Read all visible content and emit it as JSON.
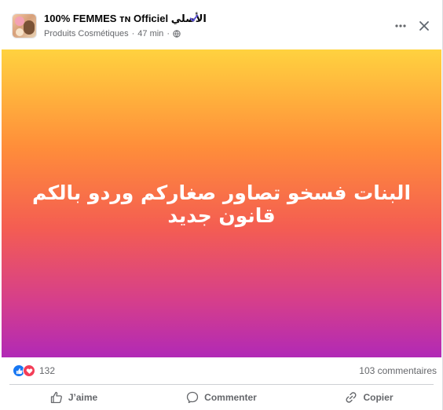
{
  "header": {
    "page_name": "100% FEMMES ᴛɴ Officiel الأصلي",
    "category": "Produits Cosmétiques",
    "separator": "·",
    "time": "47 min",
    "more_icon": "more-horizontal-icon",
    "close_icon": "close-icon",
    "verified_color": "#5b51d8"
  },
  "post": {
    "text": "البنات فسخو تصاور صغاركم وردو بالكم قانون جديد",
    "gradient_colors": [
      "#ffd23f",
      "#ff8d3a",
      "#f45d52",
      "#d53e8c",
      "#b129b6"
    ]
  },
  "stats": {
    "reaction_count": "132",
    "comments": "103 commentaires"
  },
  "actions": {
    "like_label": "J’aime",
    "comment_label": "Commenter",
    "copy_label": "Copier"
  }
}
